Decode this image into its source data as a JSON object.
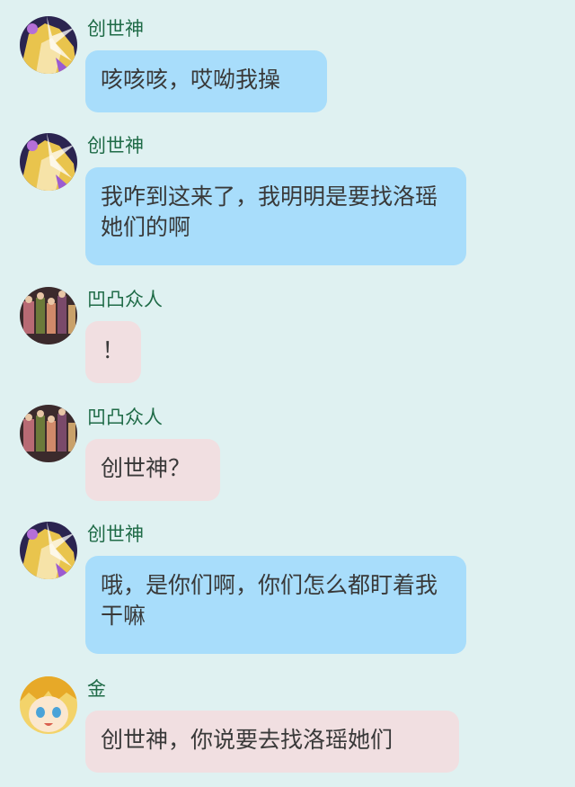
{
  "messages": [
    {
      "sender": "创世神",
      "avatar": "goddess-avatar-icon",
      "bubble_color": "#a8ddfb",
      "text": "咳咳咳，哎呦我操"
    },
    {
      "sender": "创世神",
      "avatar": "goddess-avatar-icon",
      "bubble_color": "#a8ddfb",
      "text": "我咋到这来了，我明明是要找洛瑶她们的啊"
    },
    {
      "sender": "凹凸众人",
      "avatar": "group-avatar-icon",
      "bubble_color": "#f1dfe1",
      "text": "！"
    },
    {
      "sender": "凹凸众人",
      "avatar": "group-avatar-icon",
      "bubble_color": "#f1dfe1",
      "text": "创世神？"
    },
    {
      "sender": "创世神",
      "avatar": "goddess-avatar-icon",
      "bubble_color": "#a8ddfb",
      "text": "哦，是你们啊，你们怎么都盯着我干嘛"
    },
    {
      "sender": "金",
      "avatar": "jin-avatar-icon",
      "bubble_color": "#f1dfe1",
      "text": "创世神，你说要去找洛瑶她们"
    }
  ]
}
